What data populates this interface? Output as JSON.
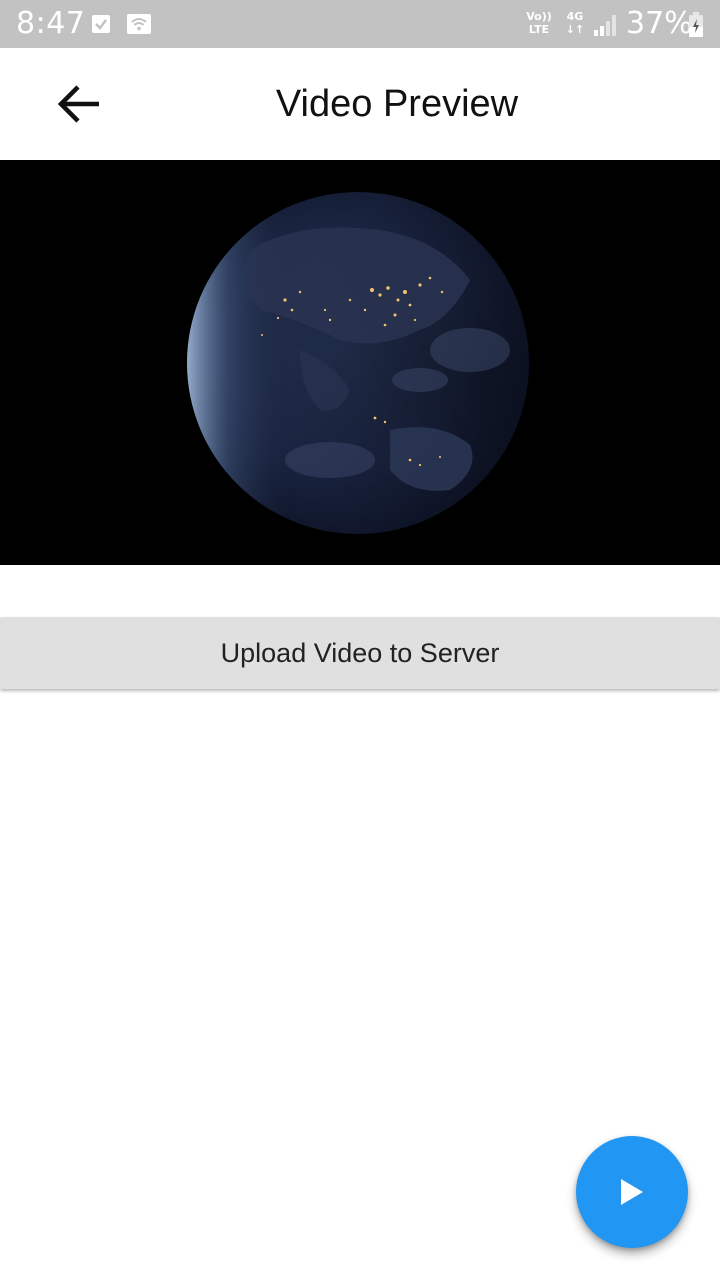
{
  "status_bar": {
    "time": "8:47",
    "volte_line1": "Vo))",
    "volte_line2": "LTE",
    "network": "4G",
    "network_arrows": "↓↑",
    "battery_text": "37%",
    "icons": [
      "check-notification-icon",
      "wifi-notification-icon",
      "signal-icon",
      "battery-charging-icon"
    ]
  },
  "app_bar": {
    "title": "Video Preview",
    "back_icon": "arrow-back-icon"
  },
  "video": {
    "content": "earth-at-night"
  },
  "actions": {
    "upload_label": "Upload Video to Server"
  },
  "fab": {
    "icon": "play-icon",
    "color": "#2196f3"
  }
}
